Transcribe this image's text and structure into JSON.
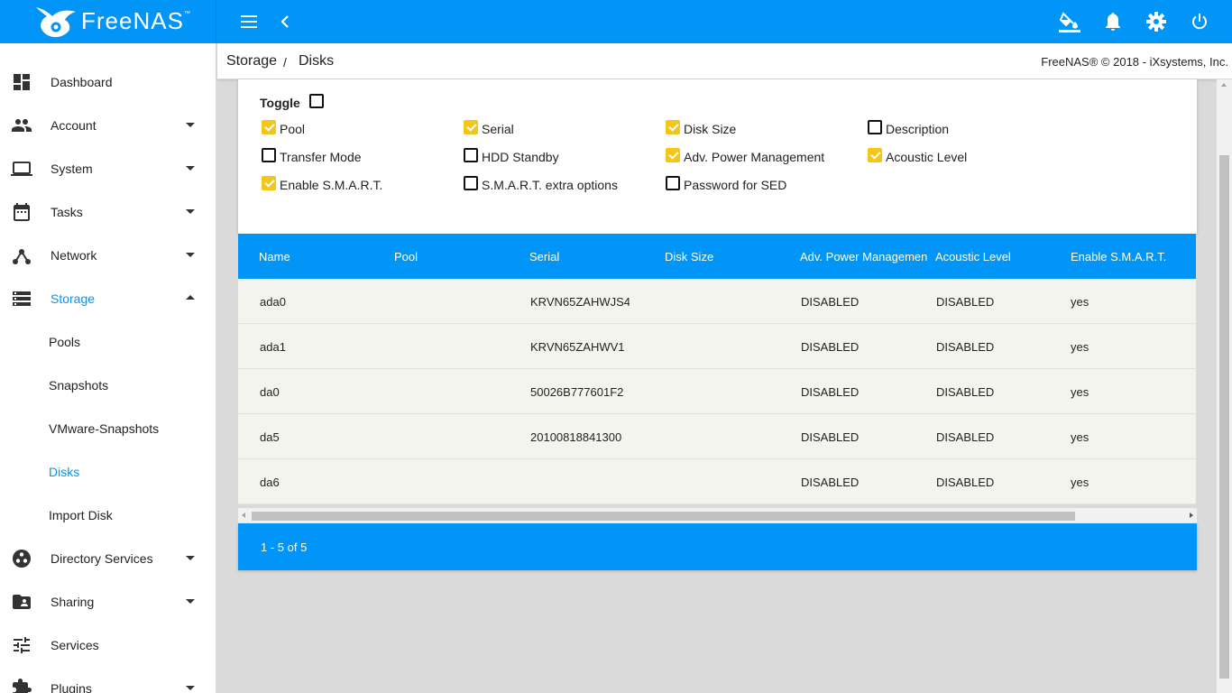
{
  "brand": {
    "name": "FreeNAS",
    "tm": "™",
    "color": "#0095f6"
  },
  "header_icons": [
    "menu-icon",
    "chevron-left-icon",
    "theme-bucket-icon",
    "bell-icon",
    "gear-icon",
    "power-icon"
  ],
  "sidebar": {
    "items": [
      {
        "label": "Dashboard",
        "icon": "dashboard-icon"
      },
      {
        "label": "Account",
        "icon": "people-icon",
        "expandable": true
      },
      {
        "label": "System",
        "icon": "laptop-icon",
        "expandable": true
      },
      {
        "label": "Tasks",
        "icon": "calendar-icon",
        "expandable": true
      },
      {
        "label": "Network",
        "icon": "network-icon",
        "expandable": true
      },
      {
        "label": "Storage",
        "icon": "storage-icon",
        "expanded": true,
        "active": true
      },
      {
        "label": "Directory Services",
        "icon": "directory-icon",
        "expandable": true
      },
      {
        "label": "Sharing",
        "icon": "folder-share-icon",
        "expandable": true
      },
      {
        "label": "Services",
        "icon": "tune-icon"
      },
      {
        "label": "Plugins",
        "icon": "puzzle-icon",
        "expandable": true
      }
    ],
    "storage_sub": [
      {
        "label": "Pools"
      },
      {
        "label": "Snapshots"
      },
      {
        "label": "VMware-Snapshots"
      },
      {
        "label": "Disks",
        "active": true
      },
      {
        "label": "Import Disk"
      }
    ]
  },
  "breadcrumb": {
    "parent": "Storage",
    "separator": "/",
    "current": "Disks"
  },
  "copyright": "FreeNAS® © 2018 - iXsystems, Inc.",
  "toggle": {
    "label": "Toggle",
    "options": [
      {
        "label": "Pool",
        "checked": true
      },
      {
        "label": "Serial",
        "checked": true
      },
      {
        "label": "Disk Size",
        "checked": true
      },
      {
        "label": "Description",
        "checked": false
      },
      {
        "label": "Transfer Mode",
        "checked": false
      },
      {
        "label": "HDD Standby",
        "checked": false
      },
      {
        "label": "Adv. Power Management",
        "checked": true
      },
      {
        "label": "Acoustic Level",
        "checked": true
      },
      {
        "label": "Enable S.M.A.R.T.",
        "checked": true
      },
      {
        "label": "S.M.A.R.T. extra options",
        "checked": false
      },
      {
        "label": "Password for SED",
        "checked": false
      }
    ]
  },
  "table": {
    "columns": [
      "Name",
      "Pool",
      "Serial",
      "Disk Size",
      "Adv. Power Management",
      "Acoustic Level",
      "Enable S.M.A.R.T."
    ],
    "rows": [
      [
        "ada0",
        "",
        "KRVN65ZAHWJS4",
        "",
        "DISABLED",
        "DISABLED",
        "yes"
      ],
      [
        "ada1",
        "",
        "KRVN65ZAHWV1",
        "",
        "DISABLED",
        "DISABLED",
        "yes"
      ],
      [
        "da0",
        "",
        "50026B777601F2",
        "",
        "DISABLED",
        "DISABLED",
        "yes"
      ],
      [
        "da5",
        "",
        "20100818841300",
        "",
        "DISABLED",
        "DISABLED",
        "yes"
      ],
      [
        "da6",
        "",
        "",
        "",
        "DISABLED",
        "DISABLED",
        "yes"
      ]
    ]
  },
  "paginator": "1 - 5 of 5"
}
